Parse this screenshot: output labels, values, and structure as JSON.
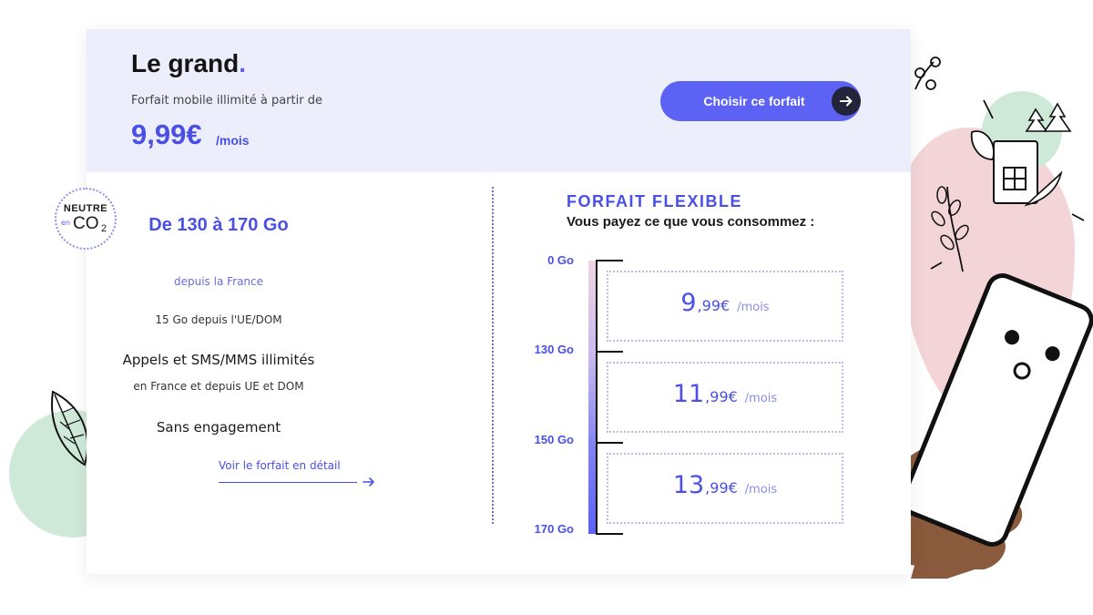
{
  "plan": {
    "name": "Le grand",
    "dot": ".",
    "subtitle": "Forfait mobile illimité à partir de",
    "price": "9,99€",
    "period": "/mois",
    "cta_label": "Choisir ce forfait"
  },
  "badge": {
    "line1": "NEUTRE",
    "en": "en",
    "co": "CO",
    "sub": "2"
  },
  "details": {
    "data_range": "De 130 à 170 Go",
    "data_range_sub": "depuis la France",
    "eu_data": "15 Go depuis l'UE/DOM",
    "calls": "Appels et SMS/MMS illimités",
    "calls_sub": "en France et depuis UE et DOM",
    "commitment": "Sans engagement",
    "detail_link": "Voir le forfait en détail"
  },
  "flexible": {
    "title": "FORFAIT FLEXIBLE",
    "subtitle": "Vous payez ce que vous consommez :",
    "ticks": [
      "0 Go",
      "130 Go",
      "150 Go",
      "170 Go"
    ],
    "tiers": [
      {
        "int": "9",
        "dec": ",99€",
        "per": "/mois"
      },
      {
        "int": "11",
        "dec": ",99€",
        "per": "/mois"
      },
      {
        "int": "13",
        "dec": ",99€",
        "per": "/mois"
      }
    ]
  },
  "colors": {
    "accent": "#5b62f4",
    "header_bg": "#eceefc",
    "arrow_circle": "#23233a",
    "pink_blob": "#f3d5d8",
    "green_circle": "#cfe9d8"
  },
  "icons": {
    "cta": "arrow-right-icon",
    "link": "arrow-right-icon"
  }
}
